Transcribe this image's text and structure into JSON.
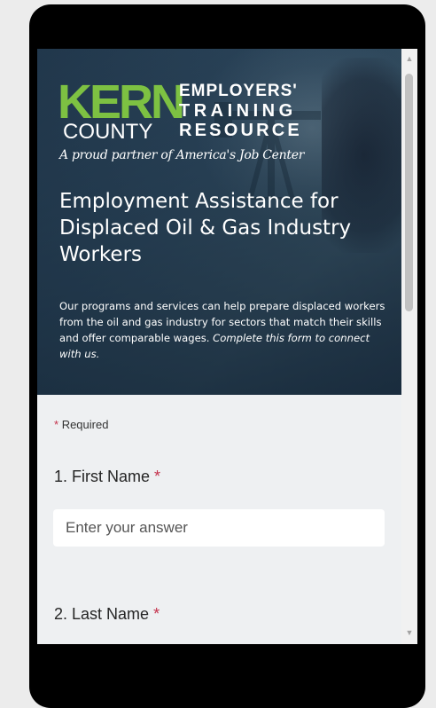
{
  "logo": {
    "kern": "KERN",
    "county": "COUNTY",
    "line1": "EMPLOYERS'",
    "line2": "TRAINING",
    "line3": "RESOURCE",
    "tagline": "A proud partner of America's Job Center"
  },
  "header": {
    "title": "Employment Assistance for Displaced Oil & Gas Industry Workers",
    "description_plain": "Our programs and services can help prepare displaced workers from the oil and gas industry for sectors that match their skills and offer comparable wages.",
    "description_italic": "Complete this form to connect with us."
  },
  "form": {
    "required_star": "*",
    "required_label": "Required",
    "questions": [
      {
        "label": "1. First Name",
        "star": "*",
        "placeholder": "Enter your answer"
      },
      {
        "label": "2. Last Name",
        "star": "*"
      }
    ]
  },
  "colors": {
    "accent_green": "#7dc142",
    "required_red": "#c4314b",
    "banner_dark": "#233a4f",
    "form_bg": "#eef0f2"
  }
}
